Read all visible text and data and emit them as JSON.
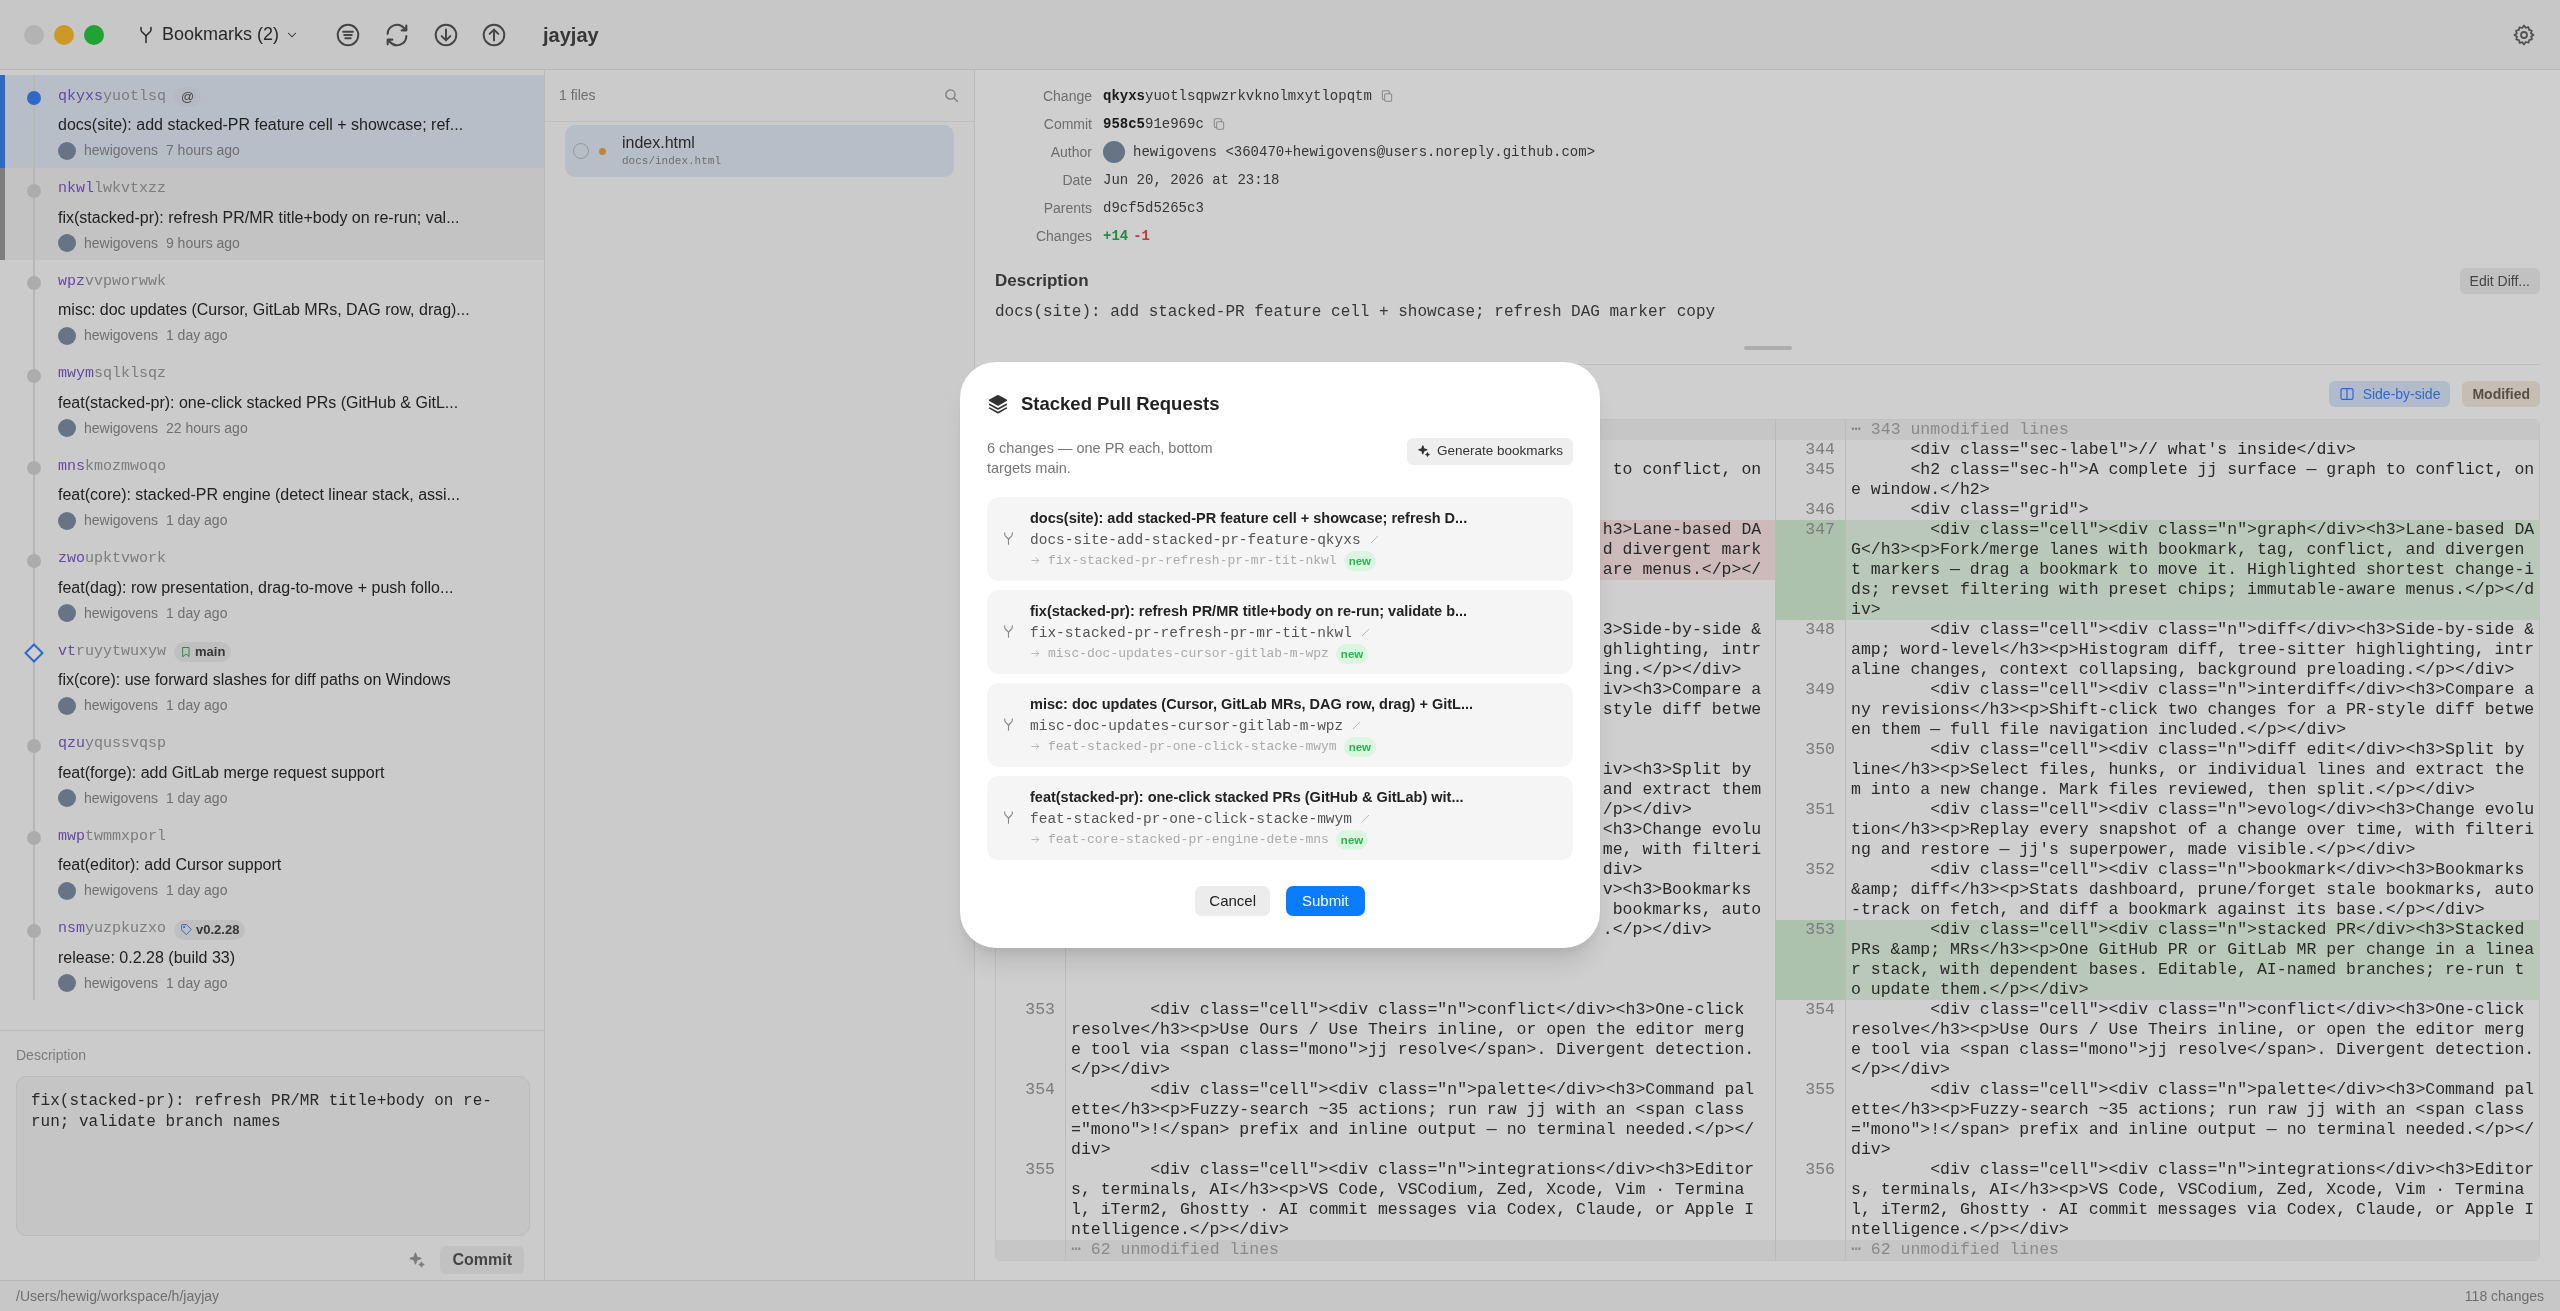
{
  "window": {
    "title": "jayjay",
    "bookmarks_menu": "Bookmarks (2)"
  },
  "commits": [
    {
      "change_prefix": "qkyxs",
      "change_rest": "yuotlsq",
      "badge": {
        "kind": "working_copy",
        "label": "@"
      },
      "title": "docs(site): add stacked-PR feature cell + showcase; ref...",
      "author": "hewigovens",
      "time": "7 hours ago",
      "kind": "current",
      "selected": true,
      "marked": false
    },
    {
      "change_prefix": "nkwl",
      "change_rest": "lwkvtxzz",
      "title": "fix(stacked-pr): refresh PR/MR title+body on re-run; val...",
      "author": "hewigovens",
      "time": "9 hours ago",
      "kind": "commit",
      "selected": false,
      "marked": true
    },
    {
      "change_prefix": "wpz",
      "change_rest": "vvpworwwk",
      "title": "misc: doc updates (Cursor, GitLab MRs, DAG row, drag)...",
      "author": "hewigovens",
      "time": "1 day ago",
      "kind": "commit",
      "selected": false,
      "marked": false
    },
    {
      "change_prefix": "mwym",
      "change_rest": "sqlklsqz",
      "title": "feat(stacked-pr): one-click stacked PRs (GitHub & GitL...",
      "author": "hewigovens",
      "time": "22 hours ago",
      "kind": "commit",
      "selected": false,
      "marked": false
    },
    {
      "change_prefix": "mns",
      "change_rest": "kmozmwoqo",
      "title": "feat(core): stacked-PR engine (detect linear stack, assi...",
      "author": "hewigovens",
      "time": "1 day ago",
      "kind": "commit",
      "selected": false,
      "marked": false
    },
    {
      "change_prefix": "zwo",
      "change_rest": "upktvwork",
      "title": "feat(dag): row presentation, drag-to-move + push follo...",
      "author": "hewigovens",
      "time": "1 day ago",
      "kind": "commit",
      "selected": false,
      "marked": false
    },
    {
      "change_prefix": "vt",
      "change_rest": "ruyytwuxyw",
      "badge": {
        "kind": "bookmark",
        "label": "main"
      },
      "title": "fix(core): use forward slashes for diff paths on Windows",
      "author": "hewigovens",
      "time": "1 day ago",
      "kind": "immutable",
      "selected": false,
      "marked": false
    },
    {
      "change_prefix": "qzu",
      "change_rest": "yqussvqsp",
      "title": "feat(forge): add GitLab merge request support",
      "author": "hewigovens",
      "time": "1 day ago",
      "kind": "commit",
      "selected": false,
      "marked": false
    },
    {
      "change_prefix": "mwp",
      "change_rest": "twmmxporl",
      "title": "feat(editor): add Cursor support",
      "author": "hewigovens",
      "time": "1 day ago",
      "kind": "commit",
      "selected": false,
      "marked": false
    },
    {
      "change_prefix": "nsm",
      "change_rest": "yuzpkuzxo",
      "badge": {
        "kind": "tag",
        "label": "v0.2.28"
      },
      "title": "release: 0.2.28 (build 33)",
      "author": "hewigovens",
      "time": "1 day ago",
      "kind": "commit",
      "selected": false,
      "marked": false
    }
  ],
  "commit_editor": {
    "label": "Description",
    "text": "fix(stacked-pr): refresh PR/MR title+body on re-run; validate branch names",
    "button": "Commit"
  },
  "files_panel": {
    "count": "1 files",
    "files": [
      {
        "name": "index.html",
        "path": "docs/index.html",
        "kind": "modified",
        "selected": true
      }
    ]
  },
  "details": {
    "fields": [
      {
        "label": "Change",
        "kind": "id",
        "bold": "qkyxs",
        "rest": "yuotlsqpwzrkvknolmxytlopqtm"
      },
      {
        "label": "Commit",
        "kind": "id",
        "bold": "958c5",
        "rest": "91e969c"
      },
      {
        "label": "Author",
        "kind": "author",
        "value": "hewigovens <360470+hewigovens@users.noreply.github.com>"
      },
      {
        "label": "Date",
        "kind": "text",
        "value": "Jun 20, 2026 at 23:18"
      },
      {
        "label": "Parents",
        "kind": "text",
        "value": "d9cf5d5265c3"
      },
      {
        "label": "Changes",
        "kind": "changes",
        "added": "+14",
        "removed": "-1"
      }
    ],
    "description_heading": "Description",
    "description": "docs(site): add stacked-PR feature cell + showcase; refresh DAG marker copy",
    "edit_button": "Edit Diff..."
  },
  "diff_toolbar": {
    "view_toggle": {
      "label": "Side-by-side",
      "selected": true
    },
    "status_badge": "Modified"
  },
  "diff": {
    "left": {
      "covered_groups": [
        {
          "kind": "context",
          "tails": [
            " to conflict, on"
          ]
        },
        {
          "kind": "deleted",
          "tails": [
            "h3>Lane-based DA",
            "d divergent mark",
            "are menus.</p></"
          ]
        },
        {
          "kind": "context",
          "tails": [
            "3>Side-by-side &",
            "ghlighting, intr",
            "ing.</p></div>",
            "iv><h3>Compare a",
            "style diff betwe"
          ]
        },
        {
          "kind": "context",
          "tails": [
            "iv><h3>Split by",
            "and extract them",
            "/p></div>",
            "<h3>Change evolu",
            "me, with filteri",
            "div>",
            "v><h3>Bookmarks",
            " bookmarks, auto",
            ".</p></div>"
          ]
        }
      ],
      "lines": [
        {
          "number": "353",
          "text": "        <div class=\"cell\"><div class=\"n\">conflict</div><h3>One-click resolve</h3><p>Use Ours / Use Theirs inline, or open the editor merge tool via <span class=\"mono\">jj resolve</span>. Divergent detection.</p></div>"
        },
        {
          "number": "354",
          "text": "        <div class=\"cell\"><div class=\"n\">palette</div><h3>Command palette</h3><p>Fuzzy-search ~35 actions; run raw jj with an <span class=\"mono\">!</span> prefix and inline output — no terminal needed.</p></div>"
        },
        {
          "number": "355",
          "text": "        <div class=\"cell\"><div class=\"n\">integrations</div><h3>Editors, terminals, AI</h3><p>VS Code, VSCodium, Zed, Xcode, Vim · Terminal, iTerm2, Ghostty · AI commit messages via Codex, Claude, or Apple Intelligence.</p></div>"
        }
      ],
      "footer": "⋯ 62 unmodified lines"
    },
    "right": {
      "header": "⋯ 343 unmodified lines",
      "lines": [
        {
          "number": "344",
          "kind": "context",
          "text": "      <div class=\"sec-label\">// what's inside</div>"
        },
        {
          "number": "345",
          "kind": "context",
          "text": "      <h2 class=\"sec-h\">A complete jj surface — graph to conflict, one window.</h2>"
        },
        {
          "number": "346",
          "kind": "context",
          "text": "      <div class=\"grid\">"
        },
        {
          "number": "347",
          "kind": "added",
          "text": "        <div class=\"cell\"><div class=\"n\">graph</div><h3>Lane-based DAG</h3><p>Fork/merge lanes with bookmark, tag, conflict, and divergent markers — drag a bookmark to move it. Highlighted shortest change-ids; revset filtering with preset chips; immutable-aware menus.</p></div>"
        },
        {
          "number": "348",
          "kind": "context",
          "text": "        <div class=\"cell\"><div class=\"n\">diff</div><h3>Side-by-side &amp; word-level</h3><p>Histogram diff, tree-sitter highlighting, intraline changes, context collapsing, background preloading.</p></div>"
        },
        {
          "number": "349",
          "kind": "context",
          "text": "        <div class=\"cell\"><div class=\"n\">interdiff</div><h3>Compare any revisions</h3><p>Shift-click two changes for a PR-style diff between them — full file navigation included.</p></div>"
        },
        {
          "number": "350",
          "kind": "context",
          "text": "        <div class=\"cell\"><div class=\"n\">diff edit</div><h3>Split by line</h3><p>Select files, hunks, or individual lines and extract them into a new change. Mark files reviewed, then split.</p></div>"
        },
        {
          "number": "351",
          "kind": "context",
          "text": "        <div class=\"cell\"><div class=\"n\">evolog</div><h3>Change evolution</h3><p>Replay every snapshot of a change over time, with filtering and restore — jj's superpower, made visible.</p></div>"
        },
        {
          "number": "352",
          "kind": "context",
          "text": "        <div class=\"cell\"><div class=\"n\">bookmark</div><h3>Bookmarks &amp; diff</h3><p>Stats dashboard, prune/forget stale bookmarks, auto-track on fetch, and diff a bookmark against its base.</p></div>"
        },
        {
          "number": "353",
          "kind": "added",
          "text": "        <div class=\"cell\"><div class=\"n\">stacked PR</div><h3>Stacked PRs &amp; MRs</h3><p>One GitHub PR or GitLab MR per change in a linear stack, with dependent bases. Editable, AI-named branches; re-run to update them.</p></div>"
        },
        {
          "number": "354",
          "kind": "context",
          "text": "        <div class=\"cell\"><div class=\"n\">conflict</div><h3>One-click resolve</h3><p>Use Ours / Use Theirs inline, or open the editor merge tool via <span class=\"mono\">jj resolve</span>. Divergent detection.</p></div>"
        },
        {
          "number": "355",
          "kind": "context",
          "text": "        <div class=\"cell\"><div class=\"n\">palette</div><h3>Command palette</h3><p>Fuzzy-search ~35 actions; run raw jj with an <span class=\"mono\">!</span> prefix and inline output — no terminal needed.</p></div>"
        },
        {
          "number": "356",
          "kind": "context",
          "text": "        <div class=\"cell\"><div class=\"n\">integrations</div><h3>Editors, terminals, AI</h3><p>VS Code, VSCodium, Zed, Xcode, Vim · Terminal, iTerm2, Ghostty · AI commit messages via Codex, Claude, or Apple Intelligence.</p></div>"
        }
      ],
      "footer": "⋯ 62 unmodified lines"
    }
  },
  "status_bar": {
    "path": "/Users/hewig/workspace/h/jayjay",
    "changes": "118 changes"
  },
  "modal": {
    "title": "Stacked Pull Requests",
    "subtitle": "6 changes — one PR each, bottom targets main.",
    "generate_button": "Generate bookmarks",
    "items": [
      {
        "title": "docs(site): add stacked-PR feature cell + showcase; refresh D...",
        "bookmark": "docs-site-add-stacked-pr-feature-qkyxs",
        "target": "fix-stacked-pr-refresh-pr-mr-tit-nkwl",
        "badge": "new"
      },
      {
        "title": "fix(stacked-pr): refresh PR/MR title+body on re-run; validate b...",
        "bookmark": "fix-stacked-pr-refresh-pr-mr-tit-nkwl",
        "target": "misc-doc-updates-cursor-gitlab-m-wpz",
        "badge": "new"
      },
      {
        "title": "misc: doc updates (Cursor, GitLab MRs, DAG row, drag) + GitL...",
        "bookmark": "misc-doc-updates-cursor-gitlab-m-wpz",
        "target": "feat-stacked-pr-one-click-stacke-mwym",
        "badge": "new"
      },
      {
        "title": "feat(stacked-pr): one-click stacked PRs (GitHub & GitLab) wit...",
        "bookmark": "feat-stacked-pr-one-click-stacke-mwym",
        "target": "feat-core-stacked-pr-engine-dete-mns",
        "badge": "new"
      }
    ],
    "cancel_button": "Cancel",
    "submit_button": "Submit"
  }
}
